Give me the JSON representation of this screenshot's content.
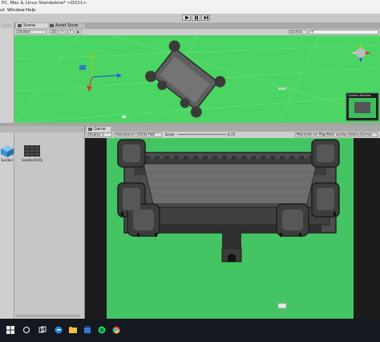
{
  "window": {
    "title": "PC, Mac & Linux Standalone* <DX11>"
  },
  "menu": [
    "ut",
    "Window",
    "Help"
  ],
  "scene": {
    "tab_scene": "Scene",
    "tab_asset_store": "Asset Store",
    "shading_mode": "Shaded",
    "mode_2d": "2D",
    "gizmos": "Gizmos",
    "search_placeholder": "All",
    "camera_preview_label": "Camera Preview"
  },
  "game": {
    "tab_label": "Game",
    "display": "Display 1",
    "resolution": "Standalone (1024x768)",
    "scale_label": "Scale",
    "scale_value": "0.75",
    "maximize_on_play": "Maximize on Play",
    "mute_audio": "Mute audio",
    "stats": "Stats",
    "gizmos": "Gizmos"
  },
  "project": {
    "assets": [
      {
        "name": "Soldier",
        "icon": "cube-prefab-icon",
        "color": "#4aa3df"
      },
      {
        "name": "Soldier/SVS",
        "icon": "texture-icon",
        "color": "#333333"
      }
    ]
  },
  "taskbar": {
    "icons": [
      "windows-start-icon",
      "search-icon",
      "task-view-icon",
      "edge-icon",
      "file-explorer-icon",
      "store-icon",
      "spotify-icon",
      "chrome-icon"
    ]
  },
  "colors": {
    "scene_green": "#4bd562",
    "game_green": "#45c463",
    "editor_gray": "#c2c2c2"
  }
}
